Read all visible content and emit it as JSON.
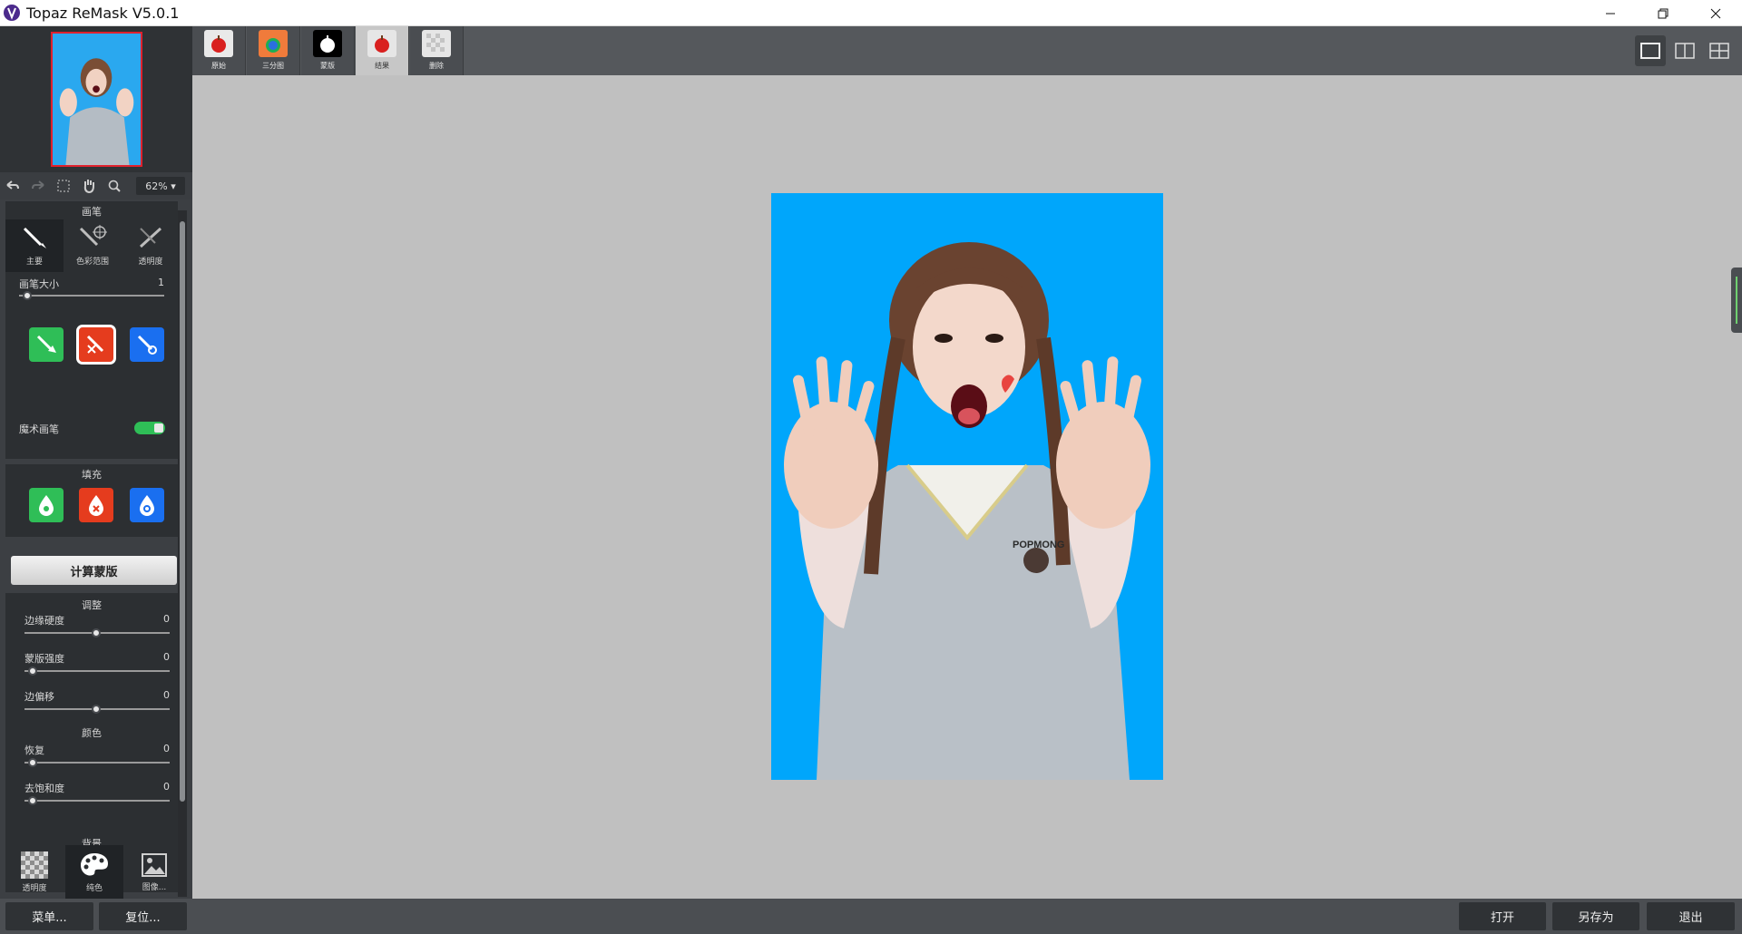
{
  "window": {
    "title": "Topaz ReMask V5.0.1"
  },
  "tabs": [
    {
      "label": "原始",
      "icon": "apple-red-icon"
    },
    {
      "label": "三分图",
      "icon": "apple-trimap-icon"
    },
    {
      "label": "蒙版",
      "icon": "apple-mask-icon"
    },
    {
      "label": "结果",
      "icon": "apple-result-icon"
    },
    {
      "label": "删除",
      "icon": "checker-icon"
    }
  ],
  "toolbar": {
    "zoom": "62% ▾"
  },
  "brush": {
    "section_title": "画笔",
    "tiles": [
      {
        "label": "主要",
        "icon": "brush-icon"
      },
      {
        "label": "色彩范围",
        "icon": "color-range-brush-icon"
      },
      {
        "label": "透明度",
        "icon": "transparency-brush-icon"
      }
    ],
    "size_label": "画笔大小",
    "size_value": "1",
    "magic_brush_label": "魔术画笔"
  },
  "fill": {
    "section_title": "填充"
  },
  "compute_button": "计算蒙版",
  "adjust": {
    "section_title": "调整",
    "edge_hardness": {
      "label": "边缘硬度",
      "value": "0"
    },
    "mask_strength": {
      "label": "蒙版强度",
      "value": "0"
    },
    "edge_shift": {
      "label": "边偏移",
      "value": "0"
    }
  },
  "color": {
    "section_title": "颜色",
    "recover": {
      "label": "恢复",
      "value": "0"
    },
    "desaturate": {
      "label": "去饱和度",
      "value": "0"
    }
  },
  "background": {
    "section_title": "背景",
    "options": [
      {
        "label": "透明度",
        "icon": "checkerboard-icon"
      },
      {
        "label": "纯色",
        "icon": "palette-icon"
      },
      {
        "label": "图像...",
        "icon": "image-icon"
      }
    ]
  },
  "bottom": {
    "menu": "菜单...",
    "reset": "复位...",
    "open": "打开",
    "save_as": "另存为",
    "exit": "退出"
  },
  "photo": {
    "shirt_text": "POPMONG"
  },
  "colors": {
    "photo_bg": "#00a6fb",
    "green": "#2fbe57",
    "red": "#e53c1e",
    "blue": "#1a6ff0"
  }
}
